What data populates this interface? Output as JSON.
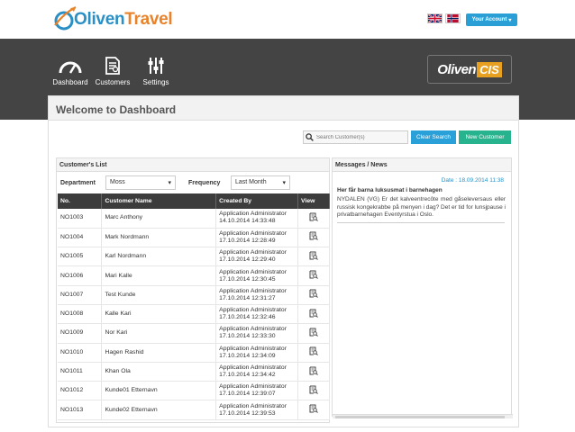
{
  "header": {
    "brand_name_a": "Oliven",
    "brand_name_b": "Travel",
    "account_label": "Your Account",
    "flags": [
      "uk-flag",
      "norway-flag"
    ]
  },
  "nav": {
    "items": [
      {
        "label": "Dashboard",
        "icon": "speedometer-icon"
      },
      {
        "label": "Customers",
        "icon": "document-icon"
      },
      {
        "label": "Settings",
        "icon": "sliders-icon"
      }
    ],
    "product_logo_a": "Oliven",
    "product_logo_b": "CIS"
  },
  "page": {
    "title": "Welcome to Dashboard",
    "search_placeholder": "Search Customer(s)",
    "clear_search_label": "Clear Search",
    "new_customer_label": "New Customer"
  },
  "customers": {
    "heading": "Customer's List",
    "department_label": "Department",
    "department_value": "Moss",
    "frequency_label": "Frequency",
    "frequency_value": "Last Month",
    "columns": [
      "No.",
      "Customer Name",
      "Created By",
      "View"
    ],
    "rows": [
      {
        "no": "NO1003",
        "name": "Marc Anthony",
        "by": "Application Administrator",
        "date": "14.10.2014 14:33:48"
      },
      {
        "no": "NO1004",
        "name": "Mark Nordmann",
        "by": "Application Administrator",
        "date": "17.10.2014 12:28:49"
      },
      {
        "no": "NO1005",
        "name": "Karl Nordmann",
        "by": "Application Administrator",
        "date": "17.10.2014 12:29:40"
      },
      {
        "no": "NO1006",
        "name": "Mari Kalle",
        "by": "Application Administrator",
        "date": "17.10.2014 12:30:45"
      },
      {
        "no": "NO1007",
        "name": "Test Kunde",
        "by": "Application Administrator",
        "date": "17.10.2014 12:31:27"
      },
      {
        "no": "NO1008",
        "name": "Kalle Kari",
        "by": "Application Administrator",
        "date": "17.10.2014 12:32:46"
      },
      {
        "no": "NO1009",
        "name": "Nor Kari",
        "by": "Application Administrator",
        "date": "17.10.2014 12:33:30"
      },
      {
        "no": "NO1010",
        "name": "Hagen Rashid",
        "by": "Application Administrator",
        "date": "17.10.2014 12:34:09"
      },
      {
        "no": "NO1011",
        "name": "Khan Ola",
        "by": "Application Administrator",
        "date": "17.10.2014 12:34:42"
      },
      {
        "no": "NO1012",
        "name": "Kunde01 Etternavn",
        "by": "Application Administrator",
        "date": "17.10.2014 12:39:07"
      },
      {
        "no": "NO1013",
        "name": "Kunde02 Etternavn",
        "by": "Application Administrator",
        "date": "17.10.2014 12:39:53"
      }
    ]
  },
  "messages": {
    "heading": "Messages / News",
    "date_label": "Date :",
    "date_value": "18.09.2014 11:38",
    "title": "Her får barna luksusmat i barnehagen",
    "body": "NYDALEN (VG) Er det kalveentrecôte med gåseleversaus eller russisk kongekrabbe på menyen i dag? Det er tid for lunsjpause i privatbarnehagen Eventyrstua i Oslo."
  },
  "colors": {
    "nav_bg": "#444444",
    "accent_blue": "#2aa0d8",
    "accent_green": "#27b38e",
    "brand_orange": "#e8832a"
  }
}
